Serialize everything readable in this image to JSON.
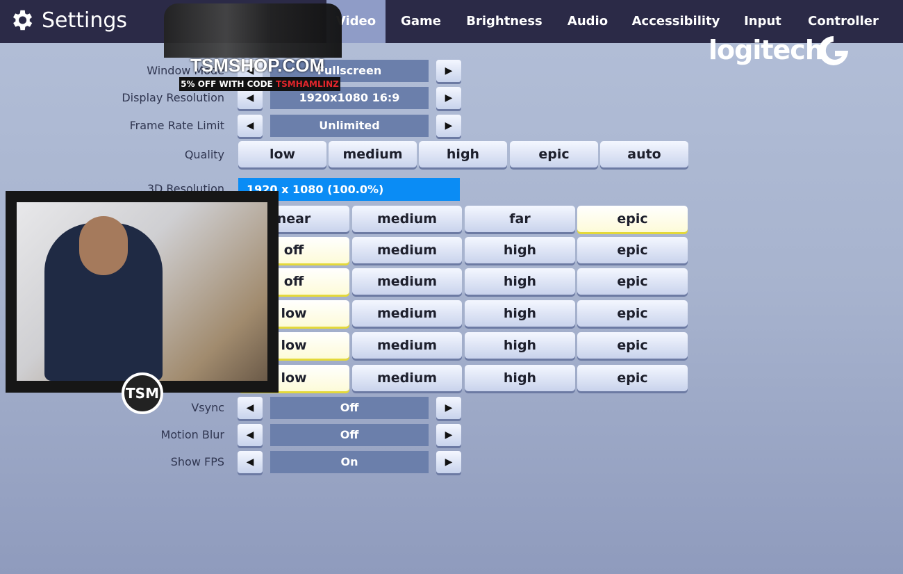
{
  "header": {
    "title": "Settings",
    "tabs": [
      {
        "label": "Video",
        "active": true
      },
      {
        "label": "Game"
      },
      {
        "label": "Brightness"
      },
      {
        "label": "Audio"
      },
      {
        "label": "Accessibility"
      },
      {
        "label": "Input"
      },
      {
        "label": "Controller"
      }
    ]
  },
  "sponsor": {
    "logo_text": "logitech"
  },
  "overlay": {
    "shop": "TSMSHOP.COM",
    "code_prefix": "5% OFF WITH CODE",
    "code": "TSMHAMLINZ",
    "cam_logo": "TSM"
  },
  "settings": {
    "window_mode": {
      "label": "Window Mode",
      "value": "Fullscreen"
    },
    "display_resolution": {
      "label": "Display Resolution",
      "value": "1920x1080 16:9"
    },
    "frame_rate": {
      "label": "Frame Rate Limit",
      "value": "Unlimited"
    },
    "quality": {
      "label": "Quality",
      "options": [
        "low",
        "medium",
        "high",
        "epic",
        "auto"
      ]
    },
    "res3d": {
      "label": "3D Resolution",
      "value": "1920 x 1080 (100.0%)",
      "percent": 100
    },
    "rows": [
      {
        "options": [
          "near",
          "medium",
          "far",
          "epic"
        ],
        "selected": 3
      },
      {
        "options": [
          "off",
          "medium",
          "high",
          "epic"
        ],
        "selected": 0
      },
      {
        "options": [
          "off",
          "medium",
          "high",
          "epic"
        ],
        "selected": 0
      },
      {
        "options": [
          "low",
          "medium",
          "high",
          "epic"
        ],
        "selected": 0
      },
      {
        "options": [
          "low",
          "medium",
          "high",
          "epic"
        ],
        "selected": 0
      },
      {
        "options": [
          "low",
          "medium",
          "high",
          "epic"
        ],
        "selected": 0
      }
    ],
    "vsync": {
      "label": "Vsync",
      "value": "Off"
    },
    "motion_blur": {
      "label": "Motion Blur",
      "value": "Off"
    },
    "show_fps": {
      "label": "Show FPS",
      "value": "On"
    }
  },
  "colors": {
    "topbar": "#2b2a47",
    "selection": "#0a8cf5",
    "selected_button": "#e4d93a"
  }
}
